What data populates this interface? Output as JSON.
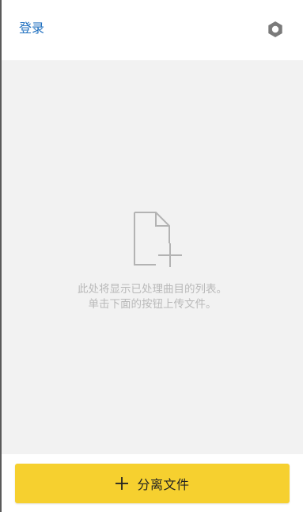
{
  "header": {
    "login_label": "登录",
    "settings_icon": "settings-gear-icon"
  },
  "empty_state": {
    "icon": "add-file-icon",
    "line1": "此处将显示已处理曲目的列表。",
    "line2": "单击下面的按钮上传文件。"
  },
  "footer": {
    "separate_label": "分离文件",
    "separate_icon": "plus-icon"
  },
  "colors": {
    "link": "#1f6fbf",
    "accent_button": "#f6d02f",
    "panel_bg": "#f2f2f2",
    "muted_text": "#b9b9b9"
  }
}
